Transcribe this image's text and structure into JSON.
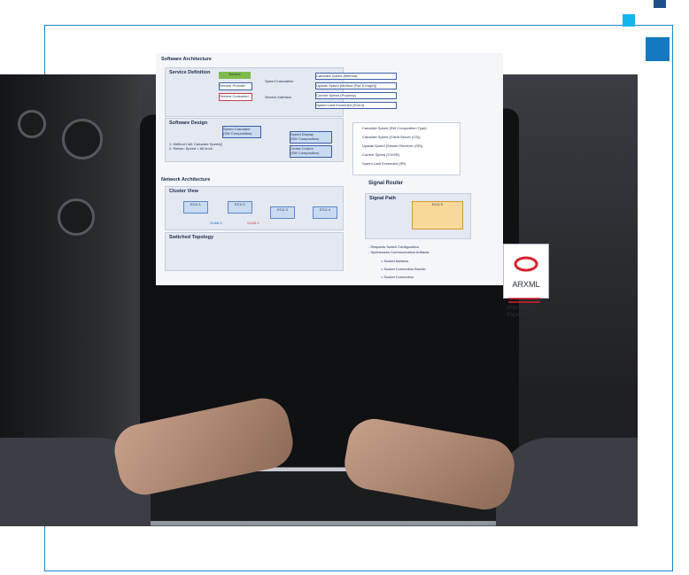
{
  "screen": {
    "software_architecture_title": "Software Architecture",
    "service_definition_title": "Service Definition",
    "service_label": "Service",
    "service_provider": "Service Provider",
    "service_consumer": "Service Consumer",
    "speed_calculation": "Speed Calculation",
    "service_interface": "Service Interface",
    "items": [
      "Calculate Speed (Method)",
      "Update Speed (Method [Fire & forget])",
      "Current Speed (Property)",
      "Speed Limit Exceeded (Event)"
    ],
    "software_design_title": "Software Design",
    "speed_calculator": "Speed Calculator",
    "speed_calculator_sub": "(SW Composition)",
    "method_notes": "1. Method Call: Calculate Speed()\n2. Return: Speed = 80 km/h",
    "speed_display": "Speed Display",
    "speed_display_sub": "(SW Composition)",
    "cruise_control": "Cruise Control",
    "cruise_control_sub": "(SW Composition)",
    "legend_items": [
      "Calculate Speed (SW Composition Type)",
      "Calculate Speed (Client Server (CS))",
      "Update Speed (Sender Receiver (SR))",
      "Current Speed (CS/SR)",
      "Speed Limit Exceeded (SR)"
    ],
    "network_architecture_title": "Network Architecture",
    "cluster_view_title": "Cluster View",
    "ecus": [
      "ECU 1",
      "ECU 2",
      "ECU 3",
      "ECU 4"
    ],
    "vlan2": "VLAN 2",
    "vlan1": "VLAN 1",
    "switched_topology_title": "Switched Topology",
    "signal_router_title": "Signal Router",
    "signal_path_title": "Signal Path",
    "signal_notes": [
      "- Respects Switch Configuration",
      "- Synthesizes Communication Artifacts:"
    ],
    "socket_items": [
      "= Socket Address",
      "= Socket Connection Bundle",
      "= Socket Connection"
    ]
  },
  "arxml_label": "ARXML",
  "import_export": "Import &\nExport",
  "colors": {
    "frame": "#1b86c6",
    "accent_light": "#14b4ec",
    "accent_dark": "#1f4f8a",
    "accent_mid": "#1479c0"
  }
}
